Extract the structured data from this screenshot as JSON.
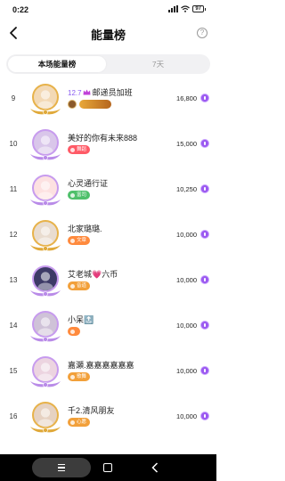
{
  "status": {
    "time": "0:22",
    "battery": "97"
  },
  "header": {
    "title": "能量榜",
    "back_icon": "back-chevron-icon",
    "help_icon": "question-circle-icon",
    "help_glyph": "?"
  },
  "tabs": [
    {
      "label": "本场能量榜",
      "active": true
    },
    {
      "label": "7天",
      "active": false
    }
  ],
  "rows": [
    {
      "rank": "9",
      "prefix": "12.7",
      "name": "邮递员加班",
      "badge_text": "",
      "badge_color": "",
      "score": "16,800"
    },
    {
      "rank": "10",
      "prefix": "",
      "name": "美好的你有未来888",
      "badge_text": "舞蹈",
      "badge_color": "#ff5a66",
      "score": "15,000"
    },
    {
      "rank": "11",
      "prefix": "",
      "name": "心灵通行证",
      "badge_text": "富司",
      "badge_color": "#4fc06b",
      "score": "10,250"
    },
    {
      "rank": "12",
      "prefix": "",
      "name": "北家璐璐.",
      "badge_text": "文章",
      "badge_color": "#ff8a3d",
      "score": "10,000"
    },
    {
      "rank": "13",
      "prefix": "",
      "name": "艾老城💗六币",
      "badge_text": "音道",
      "badge_color": "#f2a03a",
      "score": "10,000"
    },
    {
      "rank": "14",
      "prefix": "",
      "name": "小呆🔝",
      "badge_text": "",
      "badge_color": "#ff8a3d",
      "score": "10,000"
    },
    {
      "rank": "15",
      "prefix": "",
      "name": "嘉瀬.嘉嘉嘉嘉嘉嘉",
      "badge_text": "歌舞",
      "badge_color": "#f2a03a",
      "score": "10,000"
    },
    {
      "rank": "16",
      "prefix": "",
      "name": "千2.清风朋友",
      "badge_text": "心愿",
      "badge_color": "#f2a03a",
      "score": "10,000"
    }
  ],
  "colors": {
    "accent": "#8a5cf0",
    "coin": "#9b59f0"
  },
  "icons": {
    "coin": "energy-coin-icon",
    "crown": "crown-icon",
    "nav_menu": "menu-icon",
    "nav_home": "home-square-icon",
    "nav_back": "back-triangle-icon"
  }
}
